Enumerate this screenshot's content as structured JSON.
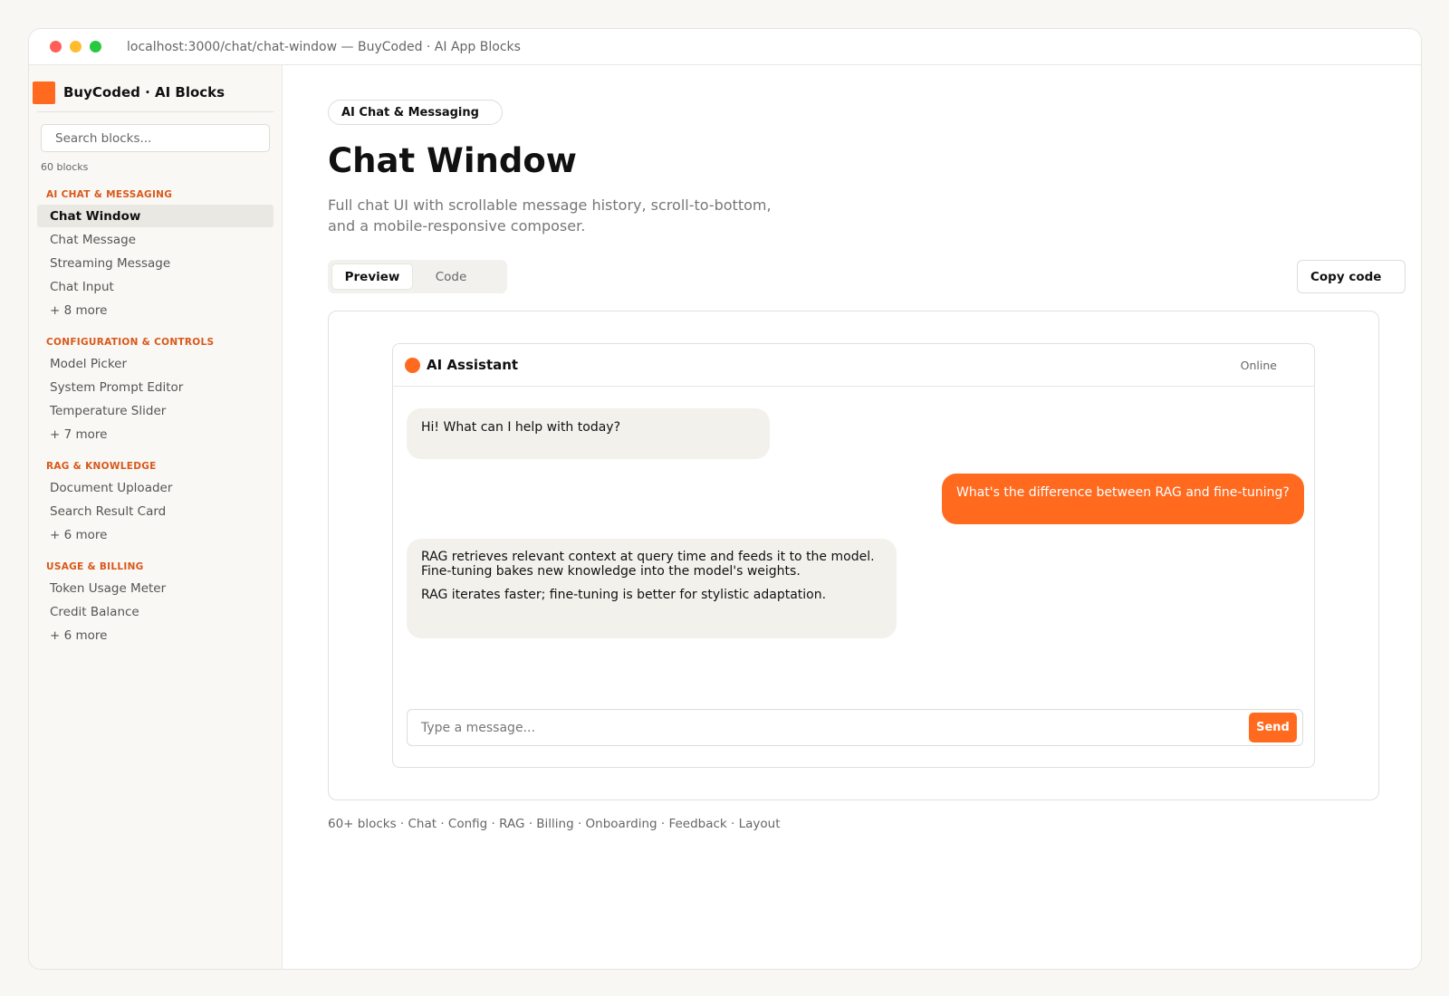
{
  "window": {
    "url": "localhost:3000/chat/chat-window — BuyCoded · AI App Blocks"
  },
  "sidebar": {
    "brand": "BuyCoded · AI Blocks",
    "search_placeholder": "Search blocks...",
    "count": "60 blocks",
    "sections": [
      {
        "title": "AI CHAT & MESSAGING",
        "items": [
          "Chat Window",
          "Chat Message",
          "Streaming Message",
          "Chat Input",
          "+ 8 more"
        ]
      },
      {
        "title": "CONFIGURATION & CONTROLS",
        "items": [
          "Model Picker",
          "System Prompt Editor",
          "Temperature Slider",
          "+ 7 more"
        ]
      },
      {
        "title": "RAG & KNOWLEDGE",
        "items": [
          "Document Uploader",
          "Search Result Card",
          "+ 6 more"
        ]
      },
      {
        "title": "USAGE & BILLING",
        "items": [
          "Token Usage Meter",
          "Credit Balance",
          "+ 6 more"
        ]
      }
    ]
  },
  "main": {
    "badge": "AI Chat & Messaging",
    "title": "Chat Window",
    "description": "Full chat UI with scrollable message history, scroll-to-bottom, and a mobile-responsive composer.",
    "tabs": {
      "preview": "Preview",
      "code": "Code"
    },
    "copy_label": "Copy code",
    "footer": "60+ blocks · Chat · Config · RAG · Billing · Onboarding · Feedback · Layout"
  },
  "chat": {
    "name": "AI Assistant",
    "status": "Online",
    "messages": [
      {
        "role": "assistant",
        "lines": [
          "Hi! What can I help with today?"
        ]
      },
      {
        "role": "user",
        "lines": [
          "What's the difference between RAG and fine-tuning?"
        ]
      },
      {
        "role": "assistant",
        "lines": [
          "RAG retrieves relevant context at query time and feeds it to the model. Fine-tuning bakes new knowledge into the model's weights.",
          "RAG iterates faster; fine-tuning is better for stylistic adaptation."
        ]
      }
    ],
    "composer_placeholder": "Type a message...",
    "send_label": "Send"
  },
  "colors": {
    "accent": "#ff6a1f",
    "section_title": "#d9581a",
    "assistant_bubble": "#f3f1ec"
  }
}
